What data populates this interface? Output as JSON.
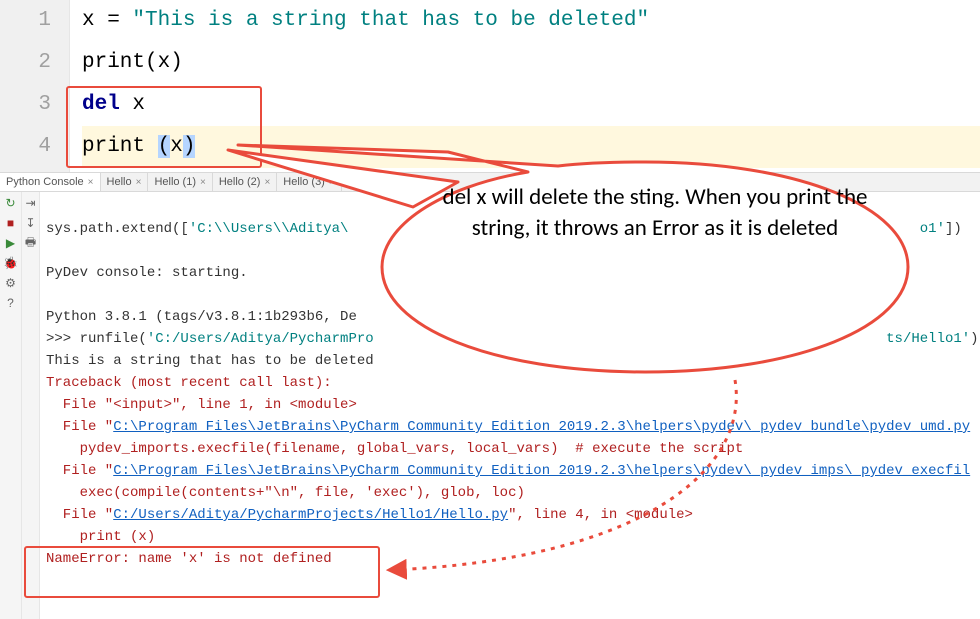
{
  "editor": {
    "gutter": [
      "1",
      "2",
      "3",
      "4"
    ],
    "line1_pre": "x = ",
    "line1_str": "\"This is a string that has to be deleted\"",
    "line2_fn": "print",
    "line2_arg": "(x)",
    "line3_kw": "del ",
    "line3_id": "x",
    "line4_fn": "print ",
    "line4_lp": "(",
    "line4_x": "x",
    "line4_rp": ")"
  },
  "tabs": {
    "items": [
      {
        "label": "Python Console",
        "active": true
      },
      {
        "label": "Hello",
        "active": false
      },
      {
        "label": "Hello (1)",
        "active": false
      },
      {
        "label": "Hello (2)",
        "active": false
      },
      {
        "label": "Hello (3)",
        "active": false
      }
    ]
  },
  "console": {
    "l0_pre": "sys.path.extend([",
    "l0_path": "'C:\\\\Users\\\\Aditya\\",
    "l0_tail_path": "o1'",
    "l0_tail": "])",
    "l1": "",
    "l2": "PyDev console: starting.",
    "l3": "",
    "l4": "Python 3.8.1 (tags/v3.8.1:1b293b6, De",
    "l5_pre": ">>> runfile(",
    "l5_path": "'C:/Users/Aditya/PycharmPro",
    "l5_tail_path": "ts/Hello1'",
    "l5_tail": ")",
    "l6": "This is a string that has to be deleted",
    "l7": "Traceback (most recent call last):",
    "l8_pre": "  File \"<input>\", line 1, in <module>",
    "l9_pre": "  File \"",
    "l9_link": "C:\\Program Files\\JetBrains\\PyCharm Community Edition 2019.2.3\\helpers\\pydev\\_pydev_bundle\\pydev_umd.py",
    "l10": "    pydev_imports.execfile(filename, global_vars, local_vars)  # execute the script",
    "l11_pre": "  File \"",
    "l11_link": "C:\\Program Files\\JetBrains\\PyCharm Community Edition 2019.2.3\\helpers\\pydev\\_pydev_imps\\_pydev_execfil",
    "l12": "    exec(compile(contents+\"\\n\", file, 'exec'), glob, loc)",
    "l13_pre": "  File \"",
    "l13_link": "C:/Users/Aditya/PycharmProjects/Hello1/Hello.py",
    "l13_post": "\", line 4, in <module>",
    "l14": "    print (x)",
    "l15": "NameError: name 'x' is not defined"
  },
  "callout": {
    "text": "del x will delete the sting. When you print the string, it throws an Error as it is deleted"
  }
}
